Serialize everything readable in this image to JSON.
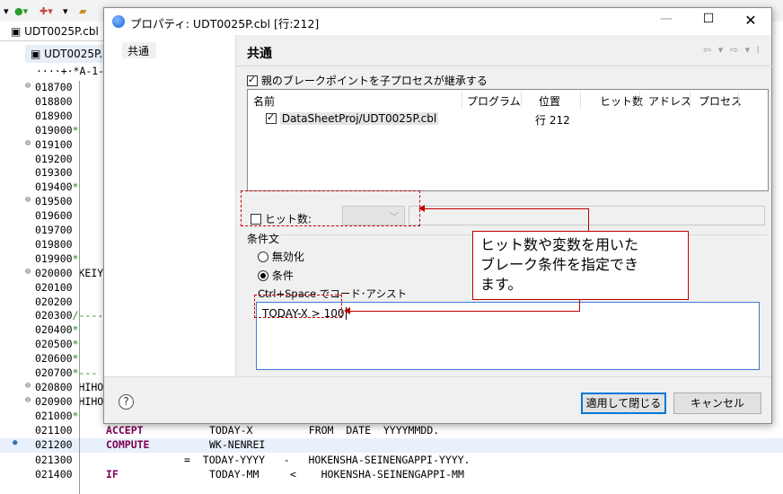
{
  "background": {
    "editor_tab": "UDT0025P.cbl ×",
    "sub_tab": "UDT0025P.cb",
    "ruler": "····+·*A-1-",
    "lines": [
      {
        "seq": "018700",
        "fold": "⊖",
        "star": "",
        "rest": ""
      },
      {
        "seq": "018800",
        "fold": "",
        "star": "",
        "rest": ""
      },
      {
        "seq": "018900",
        "fold": "",
        "star": "",
        "rest": ""
      },
      {
        "seq": "019000",
        "fold": "",
        "star": "*",
        "rest": ""
      },
      {
        "seq": "019100",
        "fold": "⊖",
        "star": "",
        "rest": ""
      },
      {
        "seq": "019200",
        "fold": "",
        "star": "",
        "rest": ""
      },
      {
        "seq": "019300",
        "fold": "",
        "star": "",
        "rest": ""
      },
      {
        "seq": "019400",
        "fold": "",
        "star": "*",
        "rest": ""
      },
      {
        "seq": "019500",
        "fold": "⊖",
        "star": "",
        "rest": ""
      },
      {
        "seq": "019600",
        "fold": "",
        "star": "",
        "rest": ""
      },
      {
        "seq": "019700",
        "fold": "",
        "star": "",
        "rest": ""
      },
      {
        "seq": "019800",
        "fold": "",
        "star": "",
        "rest": ""
      },
      {
        "seq": "019900",
        "fold": "",
        "star": "*",
        "rest": ""
      },
      {
        "seq": "020000",
        "fold": "⊖",
        "star": "",
        "rest": " KEIY"
      },
      {
        "seq": "020100",
        "fold": "",
        "star": "",
        "rest": ""
      },
      {
        "seq": "020200",
        "fold": "",
        "star": "",
        "rest": ""
      },
      {
        "seq": "020300",
        "fold": "",
        "star": "/----",
        "rest": ""
      },
      {
        "seq": "020400",
        "fold": "",
        "star": "*",
        "rest": ""
      },
      {
        "seq": "020500",
        "fold": "",
        "star": "*",
        "rest": ""
      },
      {
        "seq": "020600",
        "fold": "",
        "star": "*",
        "rest": ""
      },
      {
        "seq": "020700",
        "fold": "",
        "star": "*---",
        "rest": ""
      },
      {
        "seq": "020800",
        "fold": "⊖",
        "star": "",
        "rest": " HIHO"
      },
      {
        "seq": "020900",
        "fold": "⊖",
        "star": "",
        "rest": " HIHO"
      },
      {
        "seq": "021000",
        "fold": "",
        "star": "*",
        "rest": ""
      }
    ],
    "code_lines": [
      {
        "seq": "021100",
        "kw": "ACCEPT",
        "text": "TODAY-X         FROM  DATE  YYYYMMDD.",
        "highlight": false
      },
      {
        "seq": "021200",
        "kw": "COMPUTE",
        "text": "WK-NENREI",
        "highlight": true
      },
      {
        "seq": "021300",
        "kw": "",
        "text": "=  TODAY-YYYY   -   HOKENSHA-SEINENGAPPI-YYYY.",
        "highlight": false
      },
      {
        "seq": "021400",
        "kw": "IF",
        "text": "TODAY-MM     <    HOKENSHA-SEINENGAPPI-MM",
        "highlight": false
      }
    ]
  },
  "dialog": {
    "title": "プロパティ: UDT0025P.cbl [行:212]",
    "left_item": "共通",
    "page_title": "共通",
    "nav_icons": "⇦ ▾ ⇨ ▾ ⁞",
    "inherit_label": "親のブレークポイントを子プロセスが継承する",
    "table_headers": [
      "名前",
      "プログラム",
      "位置",
      "ヒット数",
      "アドレス",
      "プロセス"
    ],
    "row_name": "DataSheetProj/UDT0025P.cbl",
    "row_position": "行 212",
    "hit_label": "ヒット数:",
    "cond_legend": "条件文",
    "radio_disable": "無効化",
    "radio_condition": "条件",
    "assist_label": "Ctrl+Space でコード･アシスト",
    "condition_text": "TODAY-X > 100",
    "help": "?",
    "apply_close": "適用して閉じる",
    "cancel": "キャンセル"
  },
  "annotation": {
    "text": "ヒット数や変数を用いた\nブレーク条件を指定でき\nます。"
  }
}
